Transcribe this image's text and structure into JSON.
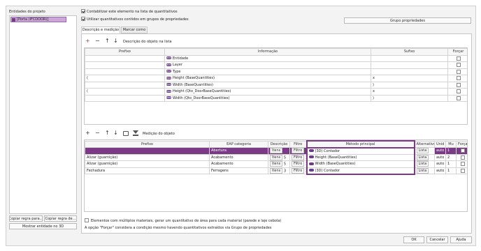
{
  "left_panel": {
    "title": "Entidades do projeto",
    "tree_item": "[Porta (IFCDOOR)]",
    "copy_rule_to": "Copiar regra para...",
    "copy_rule_from": "Copiar regra de...",
    "show_entity_3d": "Mostrar entidade no 3D"
  },
  "options": {
    "accountable": "Contabilizar este elemento na lista de quantitativos",
    "use_groups": "Utilizar quantitativos contidos em grupos de propriedades",
    "property_group_button": "Grupo propriedades"
  },
  "tabs": [
    "Descrição e medição",
    "Marcar como"
  ],
  "desc_section": {
    "label": "Descrição do objeto na lista",
    "headers": [
      "Prefixo",
      "Informação",
      "Sufixo",
      "Forçar"
    ],
    "rows": [
      {
        "prefix": "",
        "info": "Entidade",
        "suffix": "",
        "tag": "ENT"
      },
      {
        "prefix": "",
        "info": "Layer",
        "suffix": "",
        "tag": "ENT"
      },
      {
        "prefix": "",
        "info": "Type",
        "suffix": "",
        "tag": "ENT"
      },
      {
        "prefix": "(",
        "info": "Height (BaseQuantities)",
        "suffix": "x",
        "tag": "PROP"
      },
      {
        "prefix": "",
        "info": "Width (BaseQuantities)",
        "suffix": ")",
        "tag": "PROP"
      },
      {
        "prefix": "(",
        "info": "Height (Qto_DoorBaseQuantities)",
        "suffix": "x",
        "tag": "PROP"
      },
      {
        "prefix": "",
        "info": "Width (Qto_DoorBaseQuantities)",
        "suffix": ")",
        "tag": "PROP"
      }
    ]
  },
  "measure_section": {
    "label": "Medição do objeto",
    "headers": [
      "Prefixo",
      "EAP categoria",
      "Descrição",
      "Filtro",
      "Método principal",
      "Alternativo",
      "Unid",
      "Mu",
      "Forçar"
    ],
    "rows": [
      {
        "prefix": "",
        "category": "Abertura",
        "desc": "Itens",
        "desc_n": "",
        "filter": "Filtro",
        "filter_n": "",
        "method": "(3D) Contador",
        "alt": "Lista",
        "unit": "auto",
        "mu": "1"
      },
      {
        "prefix": "Alizar (guarnição)",
        "category": "Acabamento",
        "desc": "Itens",
        "desc_n": "5",
        "filter": "Filtro",
        "filter_n": "1",
        "method": "Height (BaseQuantities)",
        "alt": "Lista",
        "unit": "auto",
        "mu": "2"
      },
      {
        "prefix": "Alizar (guarnição)",
        "category": "Acabamento",
        "desc": "Itens",
        "desc_n": "5",
        "filter": "Filtro",
        "filter_n": "1",
        "method": "Width (BaseQuantities)",
        "alt": "Lista",
        "unit": "auto",
        "mu": "1"
      },
      {
        "prefix": "Fechadura",
        "category": "Ferragens",
        "desc": "Itens",
        "desc_n": "3",
        "filter": "Filtro",
        "filter_n": "3",
        "method": "(3D) Contador",
        "alt": "Lista",
        "unit": "auto",
        "mu": "1"
      }
    ]
  },
  "footer": {
    "multi_material": "Elementos com múltiplos materiais, gerar um quantitativo de área para cada material (parede e laje cebola)",
    "note": "A opção \"Forçar\" considera a condição mesmo havendo quantitativos extraídos via Grupo de propriedades",
    "ok": "OK",
    "cancel": "Cancelar",
    "help": "Ajuda"
  },
  "colors": {
    "accent": "#7b3a86",
    "tag": "#6a3c8a",
    "tree_highlight": "#c9a7d6"
  }
}
